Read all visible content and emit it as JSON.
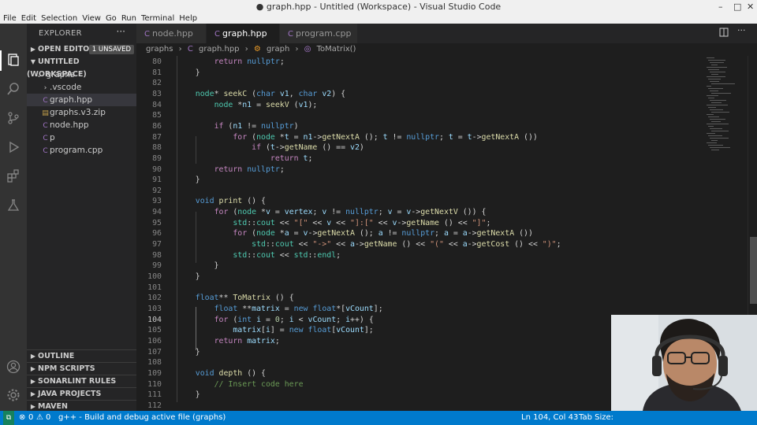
{
  "window": {
    "title": "● graph.hpp - Untitled (Workspace) - Visual Studio Code",
    "controls": [
      "–",
      "□",
      "✕"
    ]
  },
  "menu": [
    "File",
    "Edit",
    "Selection",
    "View",
    "Go",
    "Run",
    "Terminal",
    "Help"
  ],
  "sidebar": {
    "header": "EXPLORER",
    "more": "···",
    "open_editors": "OPEN EDITORS",
    "unsaved_badge": "1 UNSAVED",
    "workspace": "UNTITLED (WORKSPACE)",
    "folder": "graphs",
    "items": [
      {
        "name": ".vscode",
        "type": "folder"
      },
      {
        "name": "graph.hpp",
        "type": "cpp"
      },
      {
        "name": "graphs.v3.zip",
        "type": "zip"
      },
      {
        "name": "node.hpp",
        "type": "cpp"
      },
      {
        "name": "p",
        "type": "cpp"
      },
      {
        "name": "program.cpp",
        "type": "cpp"
      }
    ],
    "bottom_sections": [
      "OUTLINE",
      "NPM SCRIPTS",
      "SONARLINT RULES",
      "JAVA PROJECTS",
      "MAVEN"
    ]
  },
  "tabs": [
    {
      "label": "node.hpp"
    },
    {
      "label": "graph.hpp",
      "dirty": "●"
    },
    {
      "label": "program.cpp"
    }
  ],
  "breadcrumbs": [
    "graphs",
    "graph.hpp",
    "graph",
    "ToMatrix()"
  ],
  "editor": {
    "current_line": 104,
    "lines": [
      {
        "n": "80",
        "text": "        return nullptr;"
      },
      {
        "n": "81",
        "text": "    }"
      },
      {
        "n": "82",
        "text": ""
      },
      {
        "n": "83",
        "text": "    node* seekC (char v1, char v2) {"
      },
      {
        "n": "84",
        "text": "        node *n1 = seekV (v1);"
      },
      {
        "n": "85",
        "text": ""
      },
      {
        "n": "86",
        "text": "        if (n1 != nullptr)"
      },
      {
        "n": "87",
        "text": "            for (node *t = n1->getNextA (); t != nullptr; t = t->getNextA ())"
      },
      {
        "n": "88",
        "text": "                if (t->getName () == v2)"
      },
      {
        "n": "89",
        "text": "                    return t;"
      },
      {
        "n": "90",
        "text": "        return nullptr;"
      },
      {
        "n": "91",
        "text": "    }"
      },
      {
        "n": "92",
        "text": ""
      },
      {
        "n": "93",
        "text": "    void print () {"
      },
      {
        "n": "94",
        "text": "        for (node *v = vertex; v != nullptr; v = v->getNextV ()) {"
      },
      {
        "n": "95",
        "text": "            std::cout << \"[\" << v << \"]:[\" << v->getName () << \"]\";"
      },
      {
        "n": "96",
        "text": "            for (node *a = v->getNextA (); a != nullptr; a = a->getNextA ())"
      },
      {
        "n": "97",
        "text": "                std::cout << \"->\" << a->getName () << \"(\" << a->getCost () << \")\";"
      },
      {
        "n": "98",
        "text": "            std::cout << std::endl;"
      },
      {
        "n": "99",
        "text": "        }"
      },
      {
        "n": "100",
        "text": "    }"
      },
      {
        "n": "101",
        "text": ""
      },
      {
        "n": "102",
        "text": "    float** ToMatrix () {"
      },
      {
        "n": "103",
        "text": "        float **matrix = new float*[vCount];"
      },
      {
        "n": "104",
        "text": "        for (int i = 0; i < vCount; i++) {"
      },
      {
        "n": "105",
        "text": "            matrix[i] = new float[vCount];"
      },
      {
        "n": "106",
        "text": "        return matrix;"
      },
      {
        "n": "107",
        "text": "    }"
      },
      {
        "n": "108",
        "text": ""
      },
      {
        "n": "109",
        "text": "    void depth () {"
      },
      {
        "n": "110",
        "text": "        // Insert code here"
      },
      {
        "n": "111",
        "text": "    }"
      },
      {
        "n": "112",
        "text": ""
      }
    ]
  },
  "status": {
    "errors": "0",
    "warnings": "0",
    "task": "g++ - Build and debug active file (graphs)",
    "position": "Ln 104, Col 43",
    "tab_size": "Tab Size:"
  },
  "colors": {
    "accent": "#007acc",
    "sidebar_bg": "#252526",
    "editor_bg": "#1e1e1e"
  }
}
